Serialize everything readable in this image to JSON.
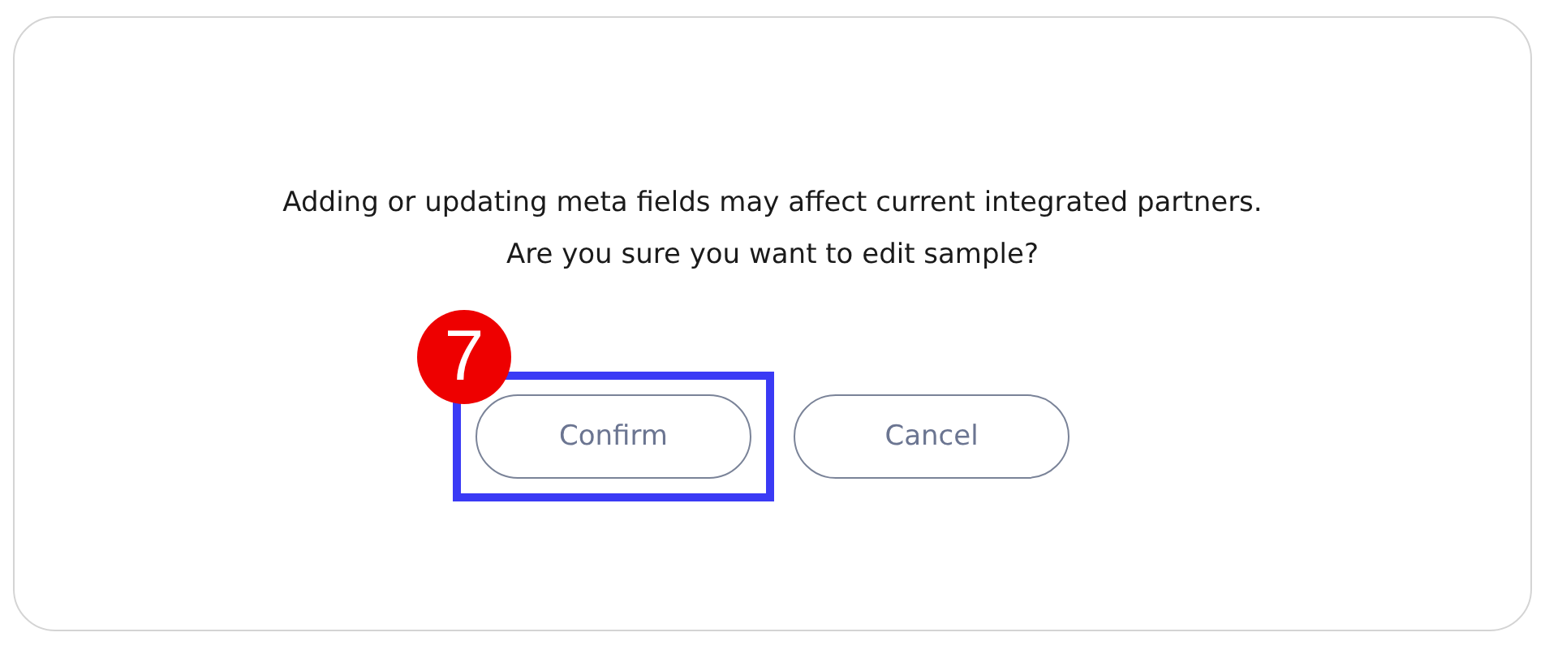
{
  "dialog": {
    "message_lines": [
      "Adding or updating meta fields may affect current integrated partners.",
      "Are you sure you want to edit sample?"
    ],
    "buttons": [
      {
        "label": "Confirm",
        "highlighted": true
      },
      {
        "label": "Cancel",
        "highlighted": false
      }
    ]
  },
  "annotation": {
    "step": "7"
  }
}
